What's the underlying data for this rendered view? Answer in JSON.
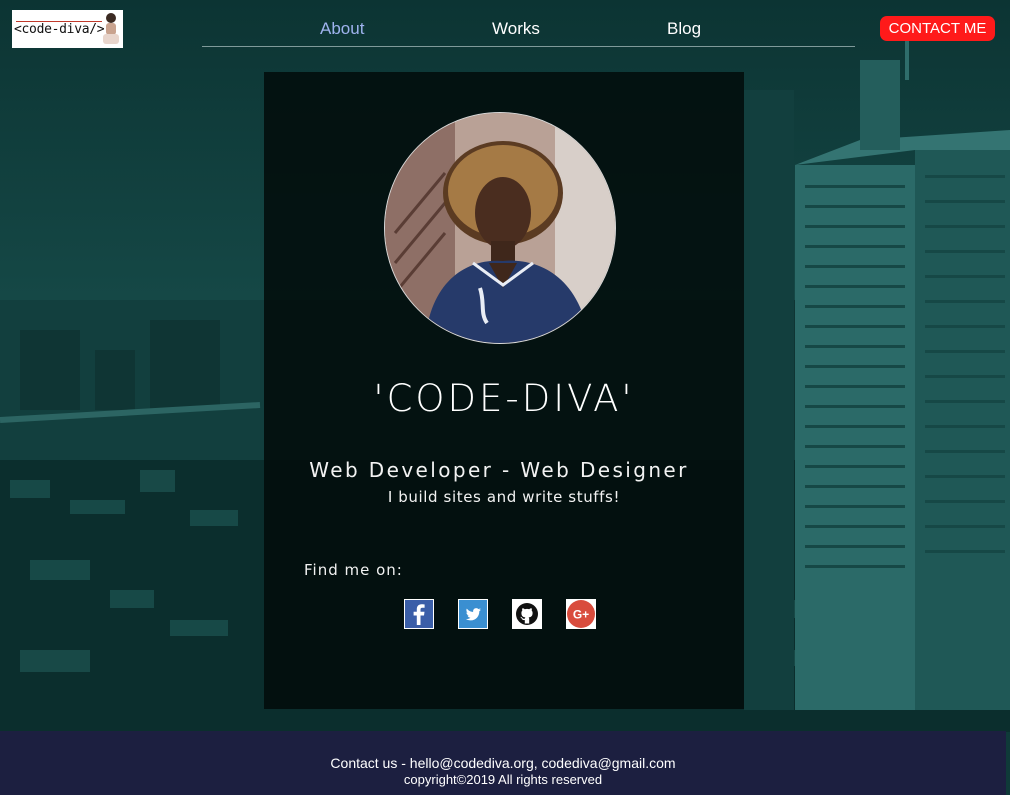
{
  "logo": {
    "text": "<code-diva/>"
  },
  "nav": {
    "items": [
      {
        "label": "About",
        "active": true
      },
      {
        "label": "Works"
      },
      {
        "label": "Blog"
      }
    ]
  },
  "contact_button": {
    "label": "CONTACT ME"
  },
  "profile": {
    "name": "'CODE-DIVA'",
    "role": "Web Developer - Web Designer",
    "tagline": "I build sites and write stuffs!",
    "find_label": "Find me on:"
  },
  "social": [
    {
      "icon": "facebook-icon"
    },
    {
      "icon": "twitter-icon"
    },
    {
      "icon": "github-icon"
    },
    {
      "icon": "google-plus-icon"
    }
  ],
  "footer": {
    "contact": "Contact us - hello@codediva.org, codediva@gmail.com",
    "copyright": "copyright©2019 All rights reserved"
  },
  "colors": {
    "contact_button": "#ff1a1a",
    "nav_active": "#9fb3ee",
    "footer_bg": "#1c1f40",
    "background": "#0f3a39"
  }
}
